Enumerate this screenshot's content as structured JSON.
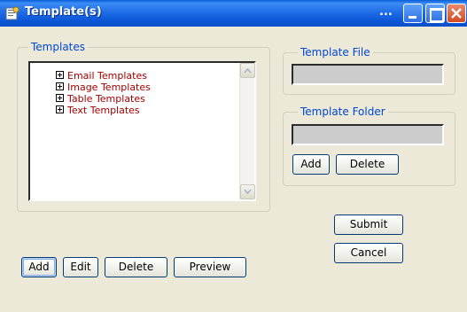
{
  "window": {
    "title": "Template(s)",
    "title_ellipsis": "...",
    "controls": [
      "minimize",
      "maximize",
      "close"
    ],
    "accent_color": "#0a5ed8",
    "close_color": "#d24b22"
  },
  "templates_group": {
    "legend": "Templates",
    "tree": [
      {
        "label": "Email Templates",
        "icon": "plus-box-icon"
      },
      {
        "label": "Image Templates",
        "icon": "plus-box-icon"
      },
      {
        "label": "Table Templates",
        "icon": "plus-box-icon"
      },
      {
        "label": "Text Templates",
        "icon": "plus-box-icon"
      }
    ],
    "label_color": "#a30000",
    "buttons": {
      "add": "Add",
      "edit": "Edit",
      "delete": "Delete",
      "preview": "Preview"
    }
  },
  "template_file_group": {
    "legend": "Template File",
    "value": ""
  },
  "template_folder_group": {
    "legend": "Template Folder",
    "value": "",
    "buttons": {
      "add": "Add",
      "delete": "Delete"
    }
  },
  "actions": {
    "submit": "Submit",
    "cancel": "Cancel"
  }
}
